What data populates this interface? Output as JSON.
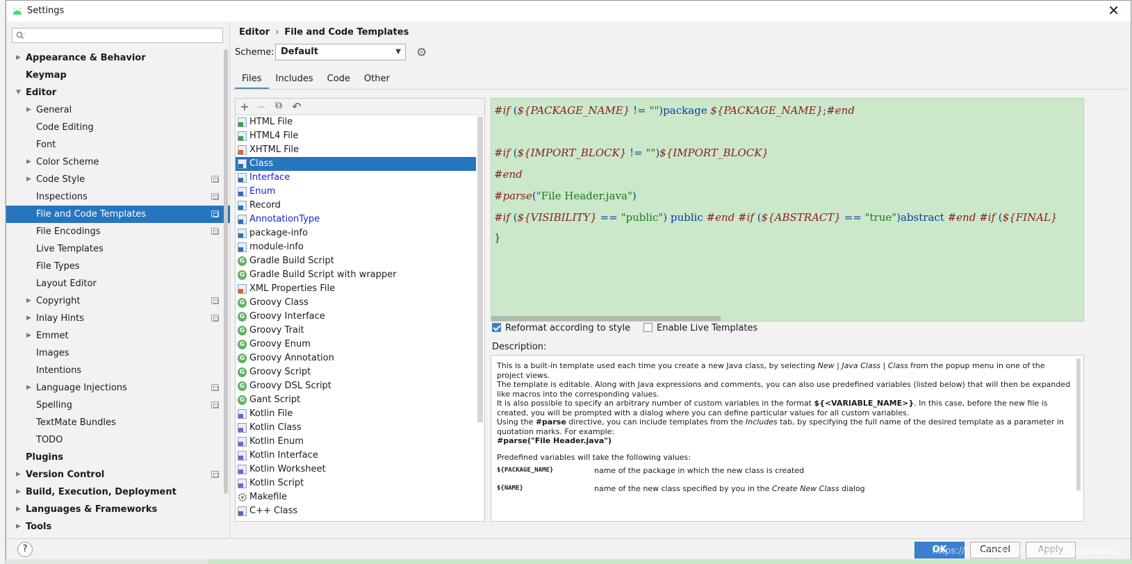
{
  "window": {
    "title": "Settings"
  },
  "search": {
    "placeholder": ""
  },
  "sidebar": {
    "items": [
      {
        "label": "Appearance & Behavior",
        "level": 0,
        "bold": true,
        "arrow": "right"
      },
      {
        "label": "Keymap",
        "level": 0,
        "bold": true
      },
      {
        "label": "Editor",
        "level": 0,
        "bold": true,
        "arrow": "down"
      },
      {
        "label": "General",
        "level": 1,
        "arrow": "right"
      },
      {
        "label": "Code Editing",
        "level": 1
      },
      {
        "label": "Font",
        "level": 1
      },
      {
        "label": "Color Scheme",
        "level": 1,
        "arrow": "right"
      },
      {
        "label": "Code Style",
        "level": 1,
        "arrow": "right",
        "project": true
      },
      {
        "label": "Inspections",
        "level": 1,
        "project": true
      },
      {
        "label": "File and Code Templates",
        "level": 1,
        "project": true,
        "selected": true
      },
      {
        "label": "File Encodings",
        "level": 1,
        "project": true
      },
      {
        "label": "Live Templates",
        "level": 1
      },
      {
        "label": "File Types",
        "level": 1
      },
      {
        "label": "Layout Editor",
        "level": 1
      },
      {
        "label": "Copyright",
        "level": 1,
        "arrow": "right",
        "project": true
      },
      {
        "label": "Inlay Hints",
        "level": 1,
        "arrow": "right",
        "project": true
      },
      {
        "label": "Emmet",
        "level": 1,
        "arrow": "right"
      },
      {
        "label": "Images",
        "level": 1
      },
      {
        "label": "Intentions",
        "level": 1
      },
      {
        "label": "Language Injections",
        "level": 1,
        "arrow": "right",
        "project": true
      },
      {
        "label": "Spelling",
        "level": 1,
        "project": true
      },
      {
        "label": "TextMate Bundles",
        "level": 1
      },
      {
        "label": "TODO",
        "level": 1
      },
      {
        "label": "Plugins",
        "level": 0,
        "bold": true
      },
      {
        "label": "Version Control",
        "level": 0,
        "bold": true,
        "arrow": "right",
        "project": true
      },
      {
        "label": "Build, Execution, Deployment",
        "level": 0,
        "bold": true,
        "arrow": "right"
      },
      {
        "label": "Languages & Frameworks",
        "level": 0,
        "bold": true,
        "arrow": "right"
      },
      {
        "label": "Tools",
        "level": 0,
        "bold": true,
        "arrow": "right"
      }
    ]
  },
  "breadcrumb": {
    "parent": "Editor",
    "separator": "›",
    "current": "File and Code Templates"
  },
  "scheme": {
    "label": "Scheme:",
    "value": "Default"
  },
  "tabs": [
    {
      "label": "Files",
      "active": true
    },
    {
      "label": "Includes"
    },
    {
      "label": "Code"
    },
    {
      "label": "Other"
    }
  ],
  "toolbar": {
    "add": "+",
    "remove": "−",
    "copy": "⧉",
    "reset": "↶"
  },
  "templates": [
    {
      "label": "HTML File",
      "icon": "html",
      "tag": "H",
      "tagColor": "#3aa13a"
    },
    {
      "label": "HTML4 File",
      "icon": "html",
      "tag": "H",
      "tagColor": "#3aa13a"
    },
    {
      "label": "XHTML File",
      "icon": "html",
      "tag": "H",
      "tagColor": "#e0632b"
    },
    {
      "label": "Class",
      "icon": "java",
      "tag": "J",
      "tagColor": "#2f6fb5",
      "selected": true
    },
    {
      "label": "Interface",
      "icon": "java",
      "tag": "J",
      "tagColor": "#2f6fb5",
      "blue": true
    },
    {
      "label": "Enum",
      "icon": "java",
      "tag": "J",
      "tagColor": "#2f6fb5",
      "blue": true
    },
    {
      "label": "Record",
      "icon": "java",
      "tag": "J",
      "tagColor": "#2f6fb5"
    },
    {
      "label": "AnnotationType",
      "icon": "java",
      "tag": "J",
      "tagColor": "#2f6fb5",
      "blue": true
    },
    {
      "label": "package-info",
      "icon": "java",
      "tag": "J",
      "tagColor": "#2f6fb5"
    },
    {
      "label": "module-info",
      "icon": "java",
      "tag": "J",
      "tagColor": "#2f6fb5"
    },
    {
      "label": "Gradle Build Script",
      "icon": "groovy"
    },
    {
      "label": "Gradle Build Script with wrapper",
      "icon": "groovy"
    },
    {
      "label": "XML Properties File",
      "icon": "xml",
      "tag": "<>",
      "tagColor": "#e0632b"
    },
    {
      "label": "Groovy Class",
      "icon": "groovy"
    },
    {
      "label": "Groovy Interface",
      "icon": "groovy"
    },
    {
      "label": "Groovy Trait",
      "icon": "groovy"
    },
    {
      "label": "Groovy Enum",
      "icon": "groovy"
    },
    {
      "label": "Groovy Annotation",
      "icon": "groovy"
    },
    {
      "label": "Groovy Script",
      "icon": "groovy"
    },
    {
      "label": "Groovy DSL Script",
      "icon": "groovy"
    },
    {
      "label": "Gant Script",
      "icon": "groovy"
    },
    {
      "label": "Kotlin File",
      "icon": "kotlin",
      "tag": "K",
      "tagColor": "#7a5fd6"
    },
    {
      "label": "Kotlin Class",
      "icon": "kotlin",
      "tag": "K",
      "tagColor": "#7a5fd6"
    },
    {
      "label": "Kotlin Enum",
      "icon": "kotlin",
      "tag": "K",
      "tagColor": "#7a5fd6"
    },
    {
      "label": "Kotlin Interface",
      "icon": "kotlin",
      "tag": "K",
      "tagColor": "#7a5fd6"
    },
    {
      "label": "Kotlin Worksheet",
      "icon": "kotlin",
      "tag": "K",
      "tagColor": "#7a5fd6"
    },
    {
      "label": "Kotlin Script",
      "icon": "kotlin",
      "tag": "K",
      "tagColor": "#7a5fd6"
    },
    {
      "label": "Makefile",
      "icon": "makefile"
    },
    {
      "label": "C++ Class",
      "icon": "cpp",
      "tag": "C",
      "tagColor": "#5b6bb8"
    }
  ],
  "editor": {
    "lines": [
      [
        [
          "kw",
          "#if"
        ],
        [
          "plain",
          " ("
        ],
        [
          "var",
          "${PACKAGE_NAME}"
        ],
        [
          "plain",
          " != "
        ],
        [
          "str",
          "\"\""
        ],
        [
          "plain",
          ")package "
        ],
        [
          "var",
          "${PACKAGE_NAME}"
        ],
        [
          "plain",
          ";"
        ],
        [
          "kw",
          "#end"
        ]
      ],
      [],
      [
        [
          "kw",
          "#if"
        ],
        [
          "plain",
          " ("
        ],
        [
          "var",
          "${IMPORT_BLOCK}"
        ],
        [
          "plain",
          " != "
        ],
        [
          "str",
          "\"\""
        ],
        [
          "plain",
          ")"
        ],
        [
          "var",
          "${IMPORT_BLOCK}"
        ]
      ],
      [
        [
          "kw",
          "#end"
        ]
      ],
      [
        [
          "kw",
          "#parse"
        ],
        [
          "plain",
          "("
        ],
        [
          "str",
          "\"File Header.java\""
        ],
        [
          "plain",
          ")"
        ]
      ],
      [
        [
          "kw",
          "#if"
        ],
        [
          "plain",
          " ("
        ],
        [
          "var",
          "${VISIBILITY}"
        ],
        [
          "plain",
          " == "
        ],
        [
          "str",
          "\"public\""
        ],
        [
          "plain",
          ") public "
        ],
        [
          "kw",
          "#end"
        ],
        [
          "plain",
          " "
        ],
        [
          "kw",
          "#if"
        ],
        [
          "plain",
          " ("
        ],
        [
          "var",
          "${ABSTRACT}"
        ],
        [
          "plain",
          " == "
        ],
        [
          "str",
          "\"true\""
        ],
        [
          "plain",
          ")abstract "
        ],
        [
          "kw",
          "#end"
        ],
        [
          "plain",
          " "
        ],
        [
          "kw",
          "#if"
        ],
        [
          "plain",
          " ("
        ],
        [
          "var",
          "${FINAL}"
        ]
      ],
      [
        [
          "plain",
          "}"
        ]
      ]
    ]
  },
  "options": {
    "reformat": {
      "label": "Reformat according to style",
      "checked": true
    },
    "live_templates": {
      "label": "Enable Live Templates",
      "checked": false
    }
  },
  "description": {
    "label": "Description:",
    "p1_a": "This is a built-in template used each time you create a new Java class, by selecting ",
    "p1_new": "New",
    "p1_sep1": " | ",
    "p1_jc": "Java Class",
    "p1_sep2": " | ",
    "p1_class": "Class",
    "p1_b": " from the popup menu in one of the project views.",
    "p2": "The template is editable. Along with Java expressions and comments, you can also use predefined variables (listed below) that will then be expanded like macros into the corresponding values.",
    "p3_a": "It is also possible to specify an arbitrary number of custom variables in the format ",
    "p3_b": "${<VARIABLE_NAME>}",
    "p3_c": ". In this case, before the new file is created, you will be prompted with a dialog where you can define particular values for all custom variables.",
    "p4_a": "Using the ",
    "p4_b": "#parse",
    "p4_c": " directive, you can include templates from the ",
    "p4_d": "Includes",
    "p4_e": " tab, by specifying the full name of the desired template as a parameter in quotation marks. For example:",
    "p5": "#parse(\"File Header.java\")",
    "p6": "Predefined variables will take the following values:",
    "vars": [
      {
        "name": "${PACKAGE_NAME}",
        "desc_a": "name of the package in which the new class is created",
        "desc_b": "",
        "desc_c": ""
      },
      {
        "name": "${NAME}",
        "desc_a": "name of the new class specified by you in the ",
        "desc_b": "Create New Class",
        "desc_c": " dialog"
      }
    ]
  },
  "footer": {
    "help": "?",
    "ok": "OK",
    "cancel": "Cancel",
    "apply": "Apply"
  },
  "watermark": "https://blog.csdn.net/wangguangyanqing"
}
